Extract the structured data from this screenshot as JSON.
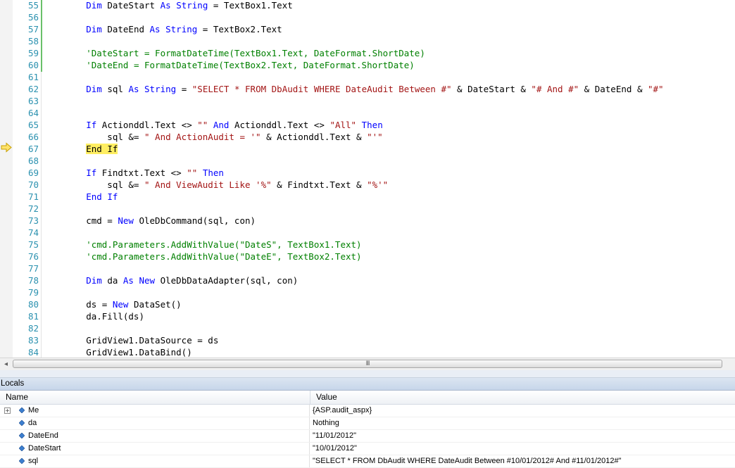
{
  "editor": {
    "lines": [
      {
        "num": "55",
        "tokens": [
          {
            "t": "        "
          },
          {
            "t": "Dim",
            "c": "kw"
          },
          {
            "t": " DateStart "
          },
          {
            "t": "As",
            "c": "kw"
          },
          {
            "t": " "
          },
          {
            "t": "String",
            "c": "kw"
          },
          {
            "t": " = TextBox1.Text"
          }
        ]
      },
      {
        "num": "56",
        "tokens": []
      },
      {
        "num": "57",
        "tokens": [
          {
            "t": "        "
          },
          {
            "t": "Dim",
            "c": "kw"
          },
          {
            "t": " DateEnd "
          },
          {
            "t": "As",
            "c": "kw"
          },
          {
            "t": " "
          },
          {
            "t": "String",
            "c": "kw"
          },
          {
            "t": " = TextBox2.Text"
          }
        ]
      },
      {
        "num": "58",
        "tokens": []
      },
      {
        "num": "59",
        "tokens": [
          {
            "t": "        "
          },
          {
            "t": "'DateStart = FormatDateTime(TextBox1.Text, DateFormat.ShortDate)",
            "c": "cm"
          }
        ]
      },
      {
        "num": "60",
        "tokens": [
          {
            "t": "        "
          },
          {
            "t": "'DateEnd = FormatDateTime(TextBox2.Text, DateFormat.ShortDate)",
            "c": "cm"
          }
        ]
      },
      {
        "num": "61",
        "tokens": []
      },
      {
        "num": "62",
        "tokens": [
          {
            "t": "        "
          },
          {
            "t": "Dim",
            "c": "kw"
          },
          {
            "t": " sql "
          },
          {
            "t": "As",
            "c": "kw"
          },
          {
            "t": " "
          },
          {
            "t": "String",
            "c": "kw"
          },
          {
            "t": " = "
          },
          {
            "t": "\"SELECT * FROM DbAudit WHERE DateAudit Between #\"",
            "c": "st"
          },
          {
            "t": " & DateStart & "
          },
          {
            "t": "\"# And #\"",
            "c": "st"
          },
          {
            "t": " & DateEnd & "
          },
          {
            "t": "\"#\"",
            "c": "st"
          }
        ]
      },
      {
        "num": "63",
        "tokens": []
      },
      {
        "num": "64",
        "tokens": []
      },
      {
        "num": "65",
        "tokens": [
          {
            "t": "        "
          },
          {
            "t": "If",
            "c": "kw"
          },
          {
            "t": " Actionddl.Text <> "
          },
          {
            "t": "\"\"",
            "c": "st"
          },
          {
            "t": " "
          },
          {
            "t": "And",
            "c": "kw"
          },
          {
            "t": " Actionddl.Text <> "
          },
          {
            "t": "\"All\"",
            "c": "st"
          },
          {
            "t": " "
          },
          {
            "t": "Then",
            "c": "kw"
          }
        ]
      },
      {
        "num": "66",
        "tokens": [
          {
            "t": "            sql &= "
          },
          {
            "t": "\" And ActionAudit = '\"",
            "c": "st"
          },
          {
            "t": " & Actionddl.Text & "
          },
          {
            "t": "\"'\"",
            "c": "st"
          }
        ]
      },
      {
        "num": "67",
        "tokens": [
          {
            "t": "        "
          },
          {
            "t": "End If",
            "c": "hl"
          }
        ]
      },
      {
        "num": "68",
        "tokens": []
      },
      {
        "num": "69",
        "tokens": [
          {
            "t": "        "
          },
          {
            "t": "If",
            "c": "kw"
          },
          {
            "t": " Findtxt.Text <> "
          },
          {
            "t": "\"\"",
            "c": "st"
          },
          {
            "t": " "
          },
          {
            "t": "Then",
            "c": "kw"
          }
        ]
      },
      {
        "num": "70",
        "tokens": [
          {
            "t": "            sql &= "
          },
          {
            "t": "\" And ViewAudit Like '%\"",
            "c": "st"
          },
          {
            "t": " & Findtxt.Text & "
          },
          {
            "t": "\"%'\"",
            "c": "st"
          }
        ]
      },
      {
        "num": "71",
        "tokens": [
          {
            "t": "        "
          },
          {
            "t": "End If",
            "c": "kw"
          }
        ]
      },
      {
        "num": "72",
        "tokens": []
      },
      {
        "num": "73",
        "tokens": [
          {
            "t": "        cmd = "
          },
          {
            "t": "New",
            "c": "kw"
          },
          {
            "t": " OleDbCommand(sql, con)"
          }
        ]
      },
      {
        "num": "74",
        "tokens": []
      },
      {
        "num": "75",
        "tokens": [
          {
            "t": "        "
          },
          {
            "t": "'cmd.Parameters.AddWithValue(\"DateS\", TextBox1.Text)",
            "c": "cm"
          }
        ]
      },
      {
        "num": "76",
        "tokens": [
          {
            "t": "        "
          },
          {
            "t": "'cmd.Parameters.AddWithValue(\"DateE\", TextBox2.Text)",
            "c": "cm"
          }
        ]
      },
      {
        "num": "77",
        "tokens": []
      },
      {
        "num": "78",
        "tokens": [
          {
            "t": "        "
          },
          {
            "t": "Dim",
            "c": "kw"
          },
          {
            "t": " da "
          },
          {
            "t": "As",
            "c": "kw"
          },
          {
            "t": " "
          },
          {
            "t": "New",
            "c": "kw"
          },
          {
            "t": " OleDbDataAdapter(sql, con)"
          }
        ]
      },
      {
        "num": "79",
        "tokens": []
      },
      {
        "num": "80",
        "tokens": [
          {
            "t": "        ds = "
          },
          {
            "t": "New",
            "c": "kw"
          },
          {
            "t": " DataSet()"
          }
        ]
      },
      {
        "num": "81",
        "tokens": [
          {
            "t": "        da.Fill(ds)"
          }
        ]
      },
      {
        "num": "82",
        "tokens": []
      },
      {
        "num": "83",
        "tokens": [
          {
            "t": "        GridView1.DataSource = ds"
          }
        ]
      },
      {
        "num": "84",
        "tokens": [
          {
            "t": "        GridView1.DataBind()"
          }
        ]
      }
    ],
    "current_line": "67",
    "colors": {
      "keyword": "#0000ff",
      "string": "#a31515",
      "comment": "#008000",
      "line_number": "#2b91af",
      "highlight": "#ffee62"
    }
  },
  "scrollbar": {
    "left_arrow": "◂",
    "grip": "III"
  },
  "locals": {
    "title": "Locals",
    "columns": {
      "name": "Name",
      "value": "Value"
    },
    "rows": [
      {
        "name": "Me",
        "value": "{ASP.audit_aspx}",
        "expandable": true
      },
      {
        "name": "da",
        "value": "Nothing",
        "expandable": false
      },
      {
        "name": "DateEnd",
        "value": "\"11/01/2012\"",
        "expandable": false
      },
      {
        "name": "DateStart",
        "value": "\"10/01/2012\"",
        "expandable": false
      },
      {
        "name": "sql",
        "value": "\"SELECT * FROM DbAudit WHERE DateAudit Between #10/01/2012# And #11/01/2012#\"",
        "expandable": false
      }
    ]
  }
}
